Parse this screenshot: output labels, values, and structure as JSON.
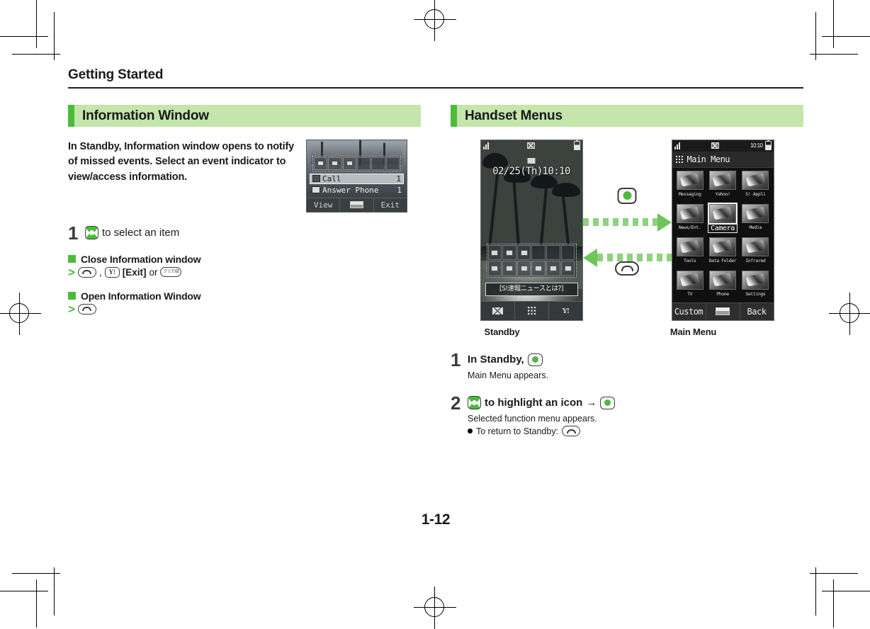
{
  "running_head": "Getting Started",
  "folio": "1-12",
  "colors": {
    "accent_green": "#4cbb3c",
    "header_band": "#c4e5ab",
    "arrow_green": "#6ec55b"
  },
  "left": {
    "section_title": "Information Window",
    "lead": "In Standby, Information window opens to notify of missed events. Select an event indicator to view/access information.",
    "step1": {
      "number": "1",
      "key_icon": "multi-selector-key-icon",
      "text": "to select an item"
    },
    "sub1": {
      "heading": "Close Information window",
      "marker": ">",
      "keys": [
        "end-key-icon",
        "yahoo-key-icon",
        "clear-key-icon"
      ],
      "exit_label": "[Exit]",
      "separator": ",",
      "or_label": "or",
      "clear_key_text": "クリア/戻"
    },
    "sub2": {
      "heading": "Open Information Window",
      "marker": ">",
      "keys": [
        "end-key-icon"
      ]
    },
    "thumbnail": {
      "name": "information-window-screenshot",
      "rows": [
        {
          "label": "Call",
          "count": "1",
          "selected": true
        },
        {
          "label": "Answer Phone",
          "count": "1",
          "selected": false
        }
      ],
      "softkeys": [
        "View",
        "",
        "Exit"
      ]
    }
  },
  "right": {
    "section_title": "Handset Menus",
    "captions": {
      "left": "Standby",
      "right": "Main Menu"
    },
    "flow": {
      "forward_key": "center-key-icon",
      "back_key": "end-key-icon"
    },
    "standby": {
      "status": {
        "signal": "signal-icon",
        "mail": "mail-icon",
        "battery": "battery-icon"
      },
      "date": "02/25(Th)10:10",
      "ticker": "[S!速報ニュースとは?]",
      "softkeys": [
        "mail-icon",
        "main-menu-icon",
        "yahoo-icon"
      ]
    },
    "main_menu": {
      "status": {
        "signal": "signal-icon",
        "mail": "mail-icon",
        "clock": "10:10",
        "battery": "battery-icon"
      },
      "title": "Main Menu",
      "items": [
        {
          "label": "Messaging",
          "selected": false
        },
        {
          "label": "Yahoo!",
          "selected": false
        },
        {
          "label": "S! Appli",
          "selected": false
        },
        {
          "label": "News/Ent.",
          "selected": false
        },
        {
          "label": "Camera",
          "selected": true
        },
        {
          "label": "Media",
          "selected": false
        },
        {
          "label": "Tools",
          "selected": false
        },
        {
          "label": "Data Folder",
          "selected": false
        },
        {
          "label": "Infrared",
          "selected": false
        },
        {
          "label": "TV",
          "selected": false
        },
        {
          "label": "Phone",
          "selected": false
        },
        {
          "label": "Settings",
          "selected": false
        }
      ],
      "softkeys": [
        "Custom",
        "",
        "Back"
      ]
    },
    "step1": {
      "number": "1",
      "text": "In Standby,",
      "key_icon": "center-key-icon",
      "note": "Main Menu appears."
    },
    "step2": {
      "number": "2",
      "key_icon": "multi-selector-key-icon",
      "text": "to highlight an icon",
      "arrow": "→",
      "key_icon2": "center-key-icon",
      "note": "Selected function menu appears.",
      "bullet": "To return to Standby:",
      "bullet_key": "end-key-icon"
    }
  }
}
